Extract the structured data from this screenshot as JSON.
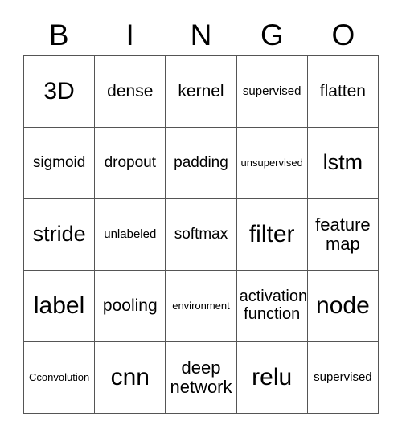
{
  "card": {
    "header": {
      "letters": [
        "B",
        "I",
        "N",
        "G",
        "O"
      ]
    },
    "grid": {
      "rows": [
        [
          {
            "text": "3D",
            "size": "xl"
          },
          {
            "text": "dense",
            "size": "md"
          },
          {
            "text": "kernel",
            "size": "md"
          },
          {
            "text": "supervised",
            "size": "xs"
          },
          {
            "text": "flatten",
            "size": "md"
          }
        ],
        [
          {
            "text": "sigmoid",
            "size": "sm"
          },
          {
            "text": "dropout",
            "size": "sm"
          },
          {
            "text": "padding",
            "size": "sm"
          },
          {
            "text": "unsupervised",
            "size": "xxs"
          },
          {
            "text": "lstm",
            "size": "lg"
          }
        ],
        [
          {
            "text": "stride",
            "size": "lg"
          },
          {
            "text": "unlabeled",
            "size": "xs"
          },
          {
            "text": "softmax",
            "size": "sm"
          },
          {
            "text": "filter",
            "size": "xl"
          },
          {
            "text": "feature\nmap",
            "size": "two-lg"
          }
        ],
        [
          {
            "text": "label",
            "size": "xl"
          },
          {
            "text": "pooling",
            "size": "md"
          },
          {
            "text": "environment",
            "size": "xxs"
          },
          {
            "text": "activation\nfunction",
            "size": "two-md"
          },
          {
            "text": "node",
            "size": "xl"
          }
        ],
        [
          {
            "text": "Cconvolution",
            "size": "xxs"
          },
          {
            "text": "cnn",
            "size": "xl"
          },
          {
            "text": "deep\nnetwork",
            "size": "two-lg"
          },
          {
            "text": "relu",
            "size": "xl"
          },
          {
            "text": "supervised",
            "size": "xs"
          }
        ]
      ]
    }
  },
  "colors": {
    "background": "#ffffff",
    "text": "#000000",
    "grid_line": "#555555"
  }
}
